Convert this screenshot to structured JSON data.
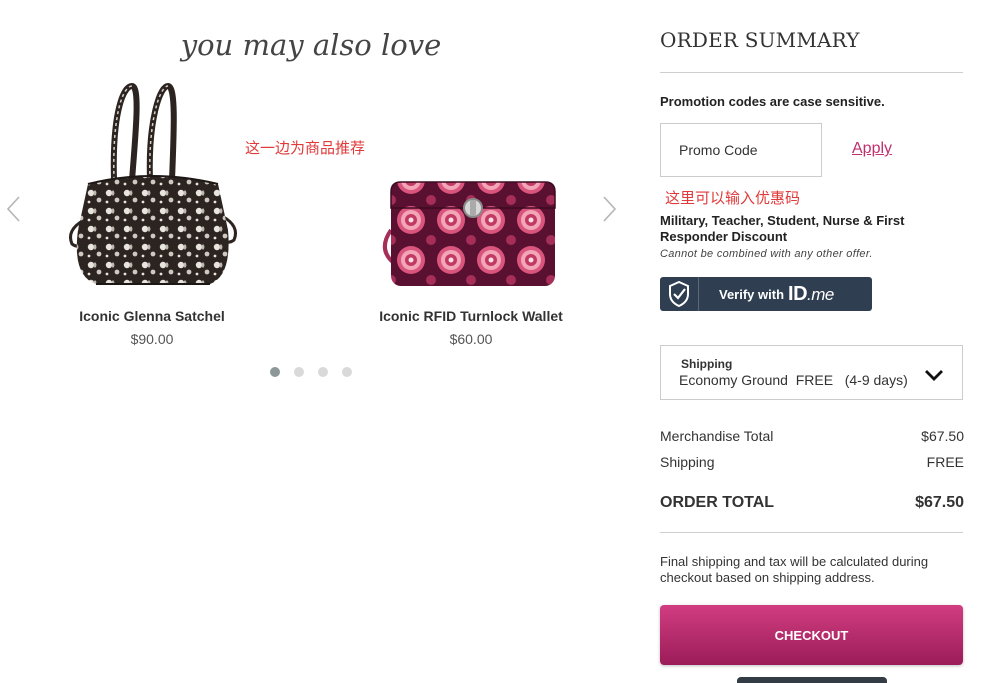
{
  "recommendations": {
    "title": "you may also love",
    "annotation": "这一边为商品推荐",
    "products": [
      {
        "name": "Iconic Glenna Satchel",
        "price": "$90.00",
        "image": "black-white-floral-satchel"
      },
      {
        "name": "Iconic RFID Turnlock Wallet",
        "price": "$60.00",
        "image": "pink-medallion-wallet"
      }
    ],
    "carousel": {
      "pages": 4,
      "active_page": 1
    },
    "icons": {
      "prev": "chevron-left-icon",
      "next": "chevron-right-icon"
    }
  },
  "summary": {
    "title": "ORDER SUMMARY",
    "promo_note": "Promotion codes are case sensitive.",
    "promo_placeholder": "Promo Code",
    "apply_label": "Apply",
    "promo_annotation": "这里可以输入优惠码",
    "military_title": "Military, Teacher, Student, Nurse & First Responder Discount",
    "military_note": "Cannot be combined with any other offer.",
    "idme": {
      "verify_text": "Verify with",
      "logo_main": "ID",
      "logo_sub": ".me"
    },
    "shipping_box": {
      "label": "Shipping",
      "value": "Economy Ground  FREE   (4-9 days)"
    },
    "rows": {
      "merchandise_label": "Merchandise Total",
      "merchandise_value": "$67.50",
      "shipping_label": "Shipping",
      "shipping_value": "FREE",
      "total_label": "ORDER TOTAL",
      "total_value": "$67.50"
    },
    "final_note": "Final shipping and tax will be calculated during checkout based on shipping address.",
    "checkout_label": "CHECKOUT"
  },
  "colors": {
    "accent": "#c0306e",
    "checkout_top": "#d13d80",
    "checkout_bottom": "#9b1c58",
    "idme_bg": "#2f3e51",
    "annotation": "#e03a3a"
  }
}
